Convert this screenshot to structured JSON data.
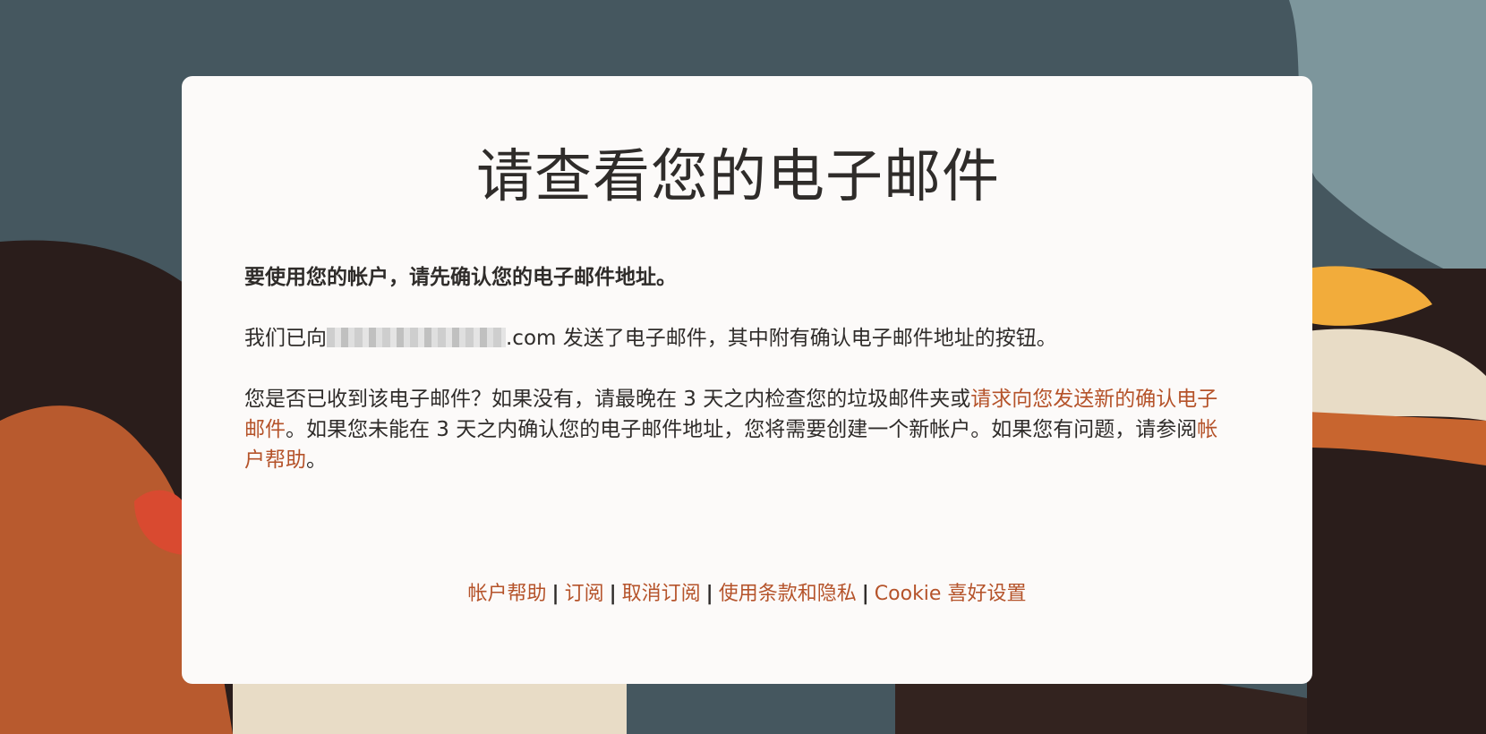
{
  "title": "请查看您的电子邮件",
  "intro": "要使用您的帐户，请先确认您的电子邮件地址。",
  "sent_message": {
    "prefix": "我们已向",
    "email_domain": ".com",
    "suffix": " 发送了电子邮件，其中附有确认电子邮件地址的按钮。"
  },
  "help_message": {
    "part1": "您是否已收到该电子邮件？如果没有，请最晚在 3 天之内检查您的垃圾邮件夹或",
    "resend_link": "请求向您发送新的确认电子邮件",
    "part2": "。如果您未能在 3 天之内确认您的电子邮件地址，您将需要创建一个新帐户。如果您有问题，请参阅",
    "account_help_link": "帐户帮助",
    "part3": "。"
  },
  "footer": {
    "links": [
      "帐户帮助",
      "订阅",
      "取消订阅",
      "使用条款和隐私",
      "Cookie 喜好设置"
    ],
    "separator": "|"
  },
  "colors": {
    "link": "#b5532a",
    "text": "#2f2c2a",
    "card": "#fcfaf9"
  }
}
